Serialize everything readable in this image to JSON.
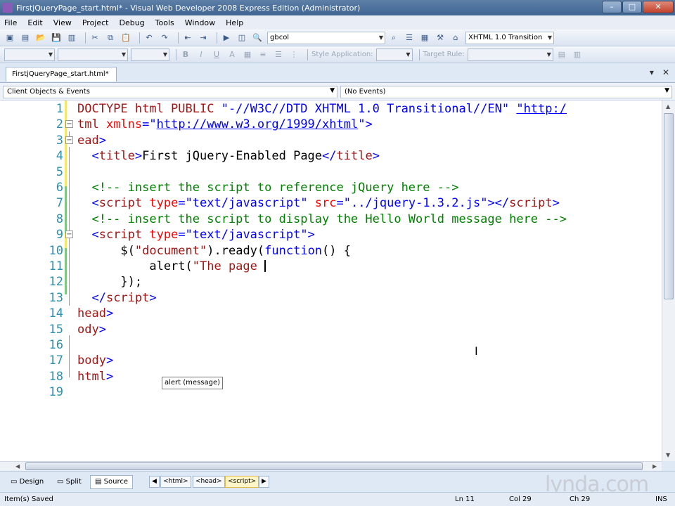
{
  "window": {
    "title": "FirstjQueryPage_start.html* - Visual Web Developer 2008 Express Edition (Administrator)",
    "minimize": "–",
    "maximize": "□",
    "close": "✕"
  },
  "menu": [
    "File",
    "Edit",
    "View",
    "Project",
    "Debug",
    "Tools",
    "Window",
    "Help"
  ],
  "toolbar1": {
    "find_combo": "gbcol",
    "doctype_combo": "XHTML 1.0 Transition"
  },
  "toolbar2": {
    "bold": "B",
    "italic": "I",
    "underline": "U",
    "style_application_label": "Style Application:",
    "target_rule_label": "Target Rule:"
  },
  "document_tab": {
    "label": "FirstjQueryPage_start.html*",
    "pin": "▾",
    "close": "✕"
  },
  "dropdowns": {
    "objects": "Client Objects & Events",
    "events": "(No Events)"
  },
  "code_lines": [
    {
      "num": "1",
      "parts": [
        [
          "k",
          "DOCTYPE html PUBLIC "
        ],
        [
          "v",
          "\"-//W3C//DTD XHTML 1.0 Transitional//EN\" "
        ],
        [
          "u",
          "\"http:/"
        ]
      ]
    },
    {
      "num": "2",
      "parts": [
        [
          "k",
          "tml "
        ],
        [
          "a",
          "xmlns"
        ],
        [
          "v",
          "=\""
        ],
        [
          "u",
          "http://www.w3.org/1999/xhtml"
        ],
        [
          "v",
          "\">"
        ]
      ]
    },
    {
      "num": "3",
      "parts": [
        [
          "k",
          "ead"
        ],
        [
          "v",
          ">"
        ]
      ]
    },
    {
      "num": "4",
      "parts": [
        [
          "v",
          "  <"
        ],
        [
          "k",
          "title"
        ],
        [
          "v",
          ">"
        ],
        [
          "t",
          "First jQuery-Enabled Page"
        ],
        [
          "v",
          "</"
        ],
        [
          "k",
          "title"
        ],
        [
          "v",
          ">"
        ]
      ]
    },
    {
      "num": "5",
      "parts": []
    },
    {
      "num": "6",
      "parts": [
        [
          "c",
          "  <!-- insert the script to reference jQuery here -->"
        ]
      ]
    },
    {
      "num": "7",
      "parts": [
        [
          "v",
          "  <"
        ],
        [
          "k",
          "script "
        ],
        [
          "a",
          "type"
        ],
        [
          "v",
          "=\"text/javascript\" "
        ],
        [
          "a",
          "src"
        ],
        [
          "v",
          "=\"../jquery-1.3.2.js\"></"
        ],
        [
          "k",
          "script"
        ],
        [
          "v",
          ">"
        ]
      ]
    },
    {
      "num": "8",
      "parts": [
        [
          "c",
          "  <!-- insert the script to display the Hello World message here -->"
        ]
      ]
    },
    {
      "num": "9",
      "parts": [
        [
          "v",
          "  <"
        ],
        [
          "k",
          "script "
        ],
        [
          "a",
          "type"
        ],
        [
          "v",
          "=\"text/javascript\">"
        ]
      ]
    },
    {
      "num": "10",
      "parts": [
        [
          "t",
          "      $("
        ],
        [
          "k",
          "\"document\""
        ],
        [
          "t",
          ")."
        ],
        [
          "t",
          "ready("
        ],
        [
          "v",
          "function"
        ],
        [
          "t",
          "() {"
        ]
      ]
    },
    {
      "num": "11",
      "parts": [
        [
          "t",
          "          alert("
        ],
        [
          "k",
          "\"The page "
        ]
      ]
    },
    {
      "num": "12",
      "parts": [
        [
          "t",
          "      });"
        ]
      ]
    },
    {
      "num": "13",
      "parts": [
        [
          "v",
          "  </"
        ],
        [
          "k",
          "script"
        ],
        [
          "v",
          ">"
        ]
      ]
    },
    {
      "num": "14",
      "parts": [
        [
          "k",
          "head"
        ],
        [
          "v",
          ">"
        ]
      ]
    },
    {
      "num": "15",
      "parts": [
        [
          "k",
          "ody"
        ],
        [
          "v",
          ">"
        ]
      ]
    },
    {
      "num": "16",
      "parts": []
    },
    {
      "num": "17",
      "parts": [
        [
          "k",
          "body"
        ],
        [
          "v",
          ">"
        ]
      ]
    },
    {
      "num": "18",
      "parts": [
        [
          "k",
          "html"
        ],
        [
          "v",
          ">"
        ]
      ]
    },
    {
      "num": "19",
      "parts": []
    }
  ],
  "tooltip": "alert (message)",
  "view_buttons": {
    "design": "Design",
    "split": "Split",
    "source": "Source"
  },
  "breadcrumbs": [
    "<html>",
    "<head>",
    "<script>"
  ],
  "watermark": "lynda.com",
  "status": {
    "message": "Item(s) Saved",
    "line": "Ln 11",
    "col": "Col 29",
    "ch": "Ch 29",
    "mode": "INS"
  }
}
